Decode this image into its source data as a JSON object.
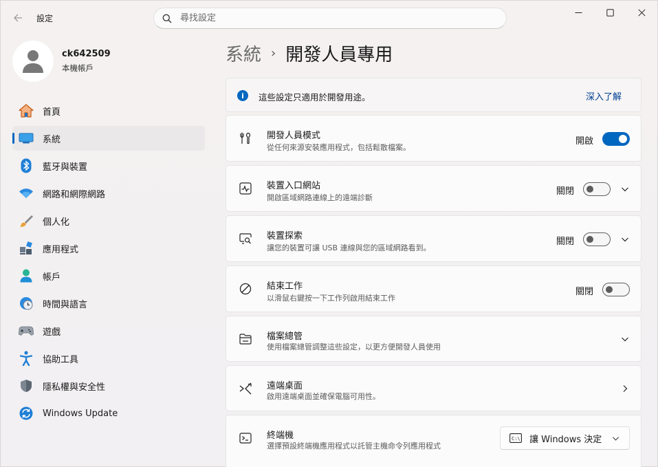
{
  "window": {
    "title": "設定"
  },
  "search": {
    "placeholder": "尋找設定"
  },
  "profile": {
    "name": "ck642509",
    "account_type": "本機帳戶"
  },
  "nav": [
    {
      "label": "首頁",
      "icon": "home-icon"
    },
    {
      "label": "系統",
      "icon": "system-icon",
      "active": true
    },
    {
      "label": "藍牙與裝置",
      "icon": "bluetooth-icon"
    },
    {
      "label": "網路和網際網路",
      "icon": "wifi-icon"
    },
    {
      "label": "個人化",
      "icon": "brush-icon"
    },
    {
      "label": "應用程式",
      "icon": "apps-icon"
    },
    {
      "label": "帳戶",
      "icon": "account-icon"
    },
    {
      "label": "時間與語言",
      "icon": "clock-globe-icon"
    },
    {
      "label": "遊戲",
      "icon": "gamepad-icon"
    },
    {
      "label": "協助工具",
      "icon": "accessibility-icon"
    },
    {
      "label": "隱私權與安全性",
      "icon": "shield-icon"
    },
    {
      "label": "Windows Update",
      "icon": "update-icon"
    }
  ],
  "breadcrumb": {
    "parent": "系統",
    "separator": "›",
    "current": "開發人員專用"
  },
  "info": {
    "text": "這些設定只適用於開發用途。",
    "link": "深入了解"
  },
  "settings": {
    "dev_mode": {
      "title": "開發人員模式",
      "desc": "從任何來源安裝應用程式，包括鬆散檔案。",
      "state": "開啟"
    },
    "device_portal": {
      "title": "裝置入口網站",
      "desc": "開啟區域網路連線上的遠端診斷",
      "state": "關閉"
    },
    "device_discovery": {
      "title": "裝置探索",
      "desc": "讓您的裝置可讓 USB 連線與您的區域網路看到。",
      "state": "關閉"
    },
    "end_task": {
      "title": "結束工作",
      "desc": "以滑鼠右鍵按一下工作列啟用結束工作",
      "state": "關閉"
    },
    "file_explorer": {
      "title": "檔案總管",
      "desc": "使用檔案總管調整這些設定，以更方便開發人員使用"
    },
    "remote_desktop": {
      "title": "遠端桌面",
      "desc": "啟用遠端桌面並確保電腦可用性。"
    },
    "terminal": {
      "title": "終端機",
      "desc": "選擇預設終端機應用程式以託管主機命令列應用程式",
      "dropdown_value": "讓 Windows 決定",
      "dropdown_icon_text": "C:\\"
    }
  },
  "colors": {
    "accent": "#0067c0",
    "link": "#003e92"
  }
}
